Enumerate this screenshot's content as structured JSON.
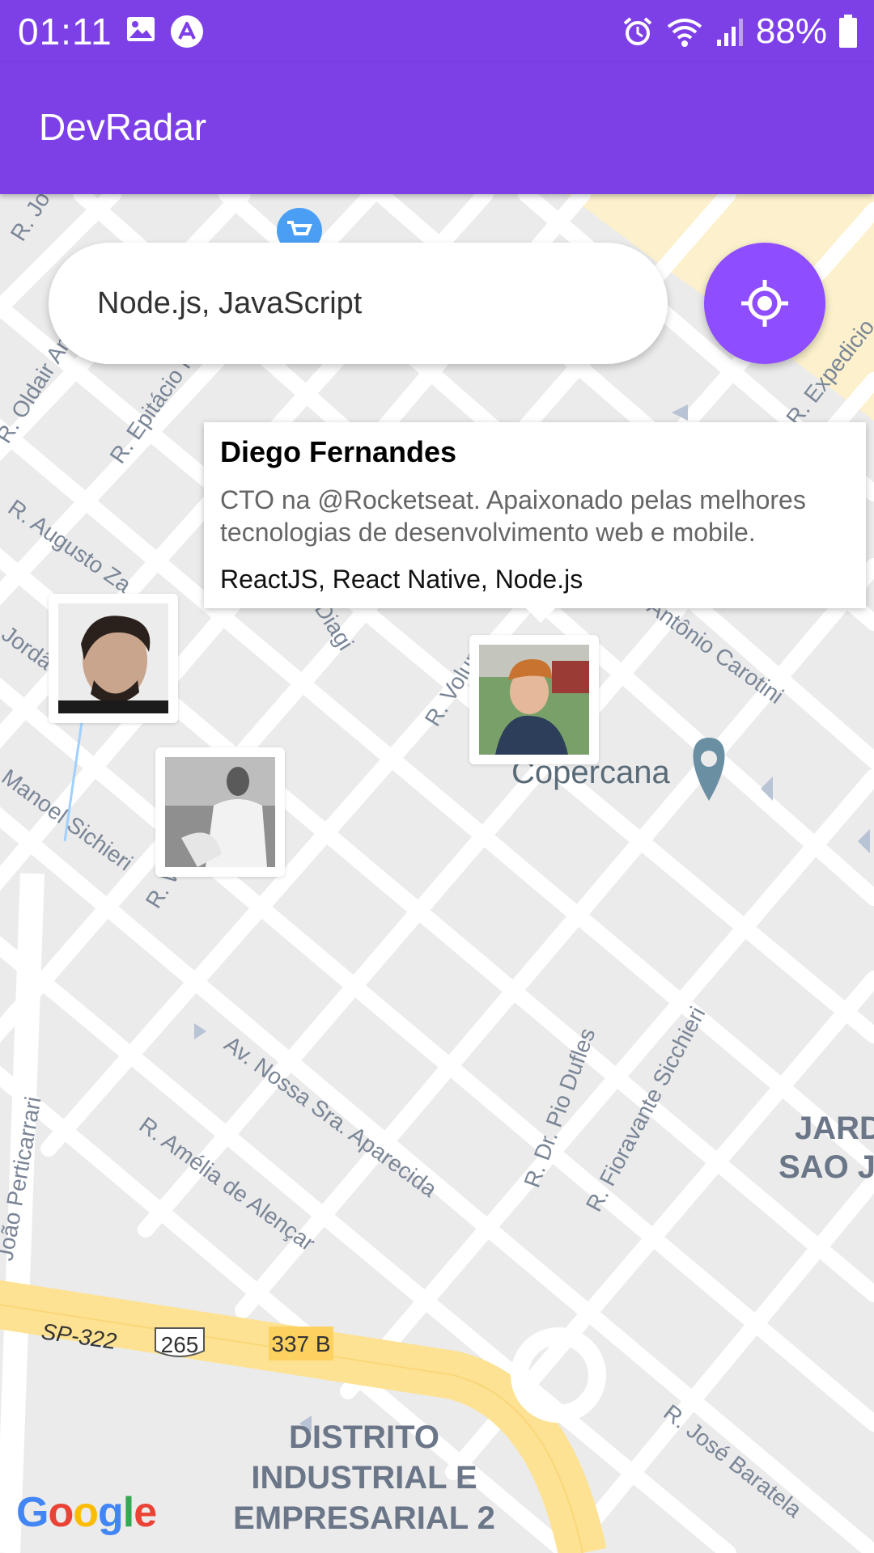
{
  "status_bar": {
    "time": "01:11",
    "battery": "88%",
    "icons": [
      "image-icon",
      "app-a-icon",
      "alarm-icon",
      "wifi-icon",
      "signal-icon",
      "battery-icon"
    ]
  },
  "app_bar": {
    "title": "DevRadar"
  },
  "search": {
    "value": "Node.js, JavaScript",
    "placeholder": ""
  },
  "locate_button": {
    "icon": "my-location-icon",
    "color": "#8e4dff"
  },
  "callout": {
    "name": "Diego Fernandes",
    "bio": "CTO na @Rocketseat. Apaixonado pelas melhores tecnologias de desenvolvimento web e mobile.",
    "techs": "ReactJS, React Native, Node.js"
  },
  "map": {
    "streets": [
      "R. Jo",
      "R. Oldair Am",
      "R. Epitácio",
      "R. Expedicio",
      "R. Augusto Za",
      "Diagi",
      "R. Volunt",
      "Antônio Carotini",
      "R. Jordã",
      "Manoel Sichieri",
      "R. W",
      "Av. Nossa Sra. Aparecida",
      "R. Amélia de Alençar",
      "R. Dr. Pio Dufles",
      "R. Fioravante Sicchieri",
      "R. José Baratela",
      "João Perticarrari",
      "SP-322"
    ],
    "places": [
      "Copercana"
    ],
    "districts": [
      "JARD",
      "SAO J",
      "DISTRITO",
      "INDUSTRIAL E",
      "EMPRESARIAL 2"
    ],
    "road_shields": [
      "265",
      "337 B"
    ]
  },
  "branding": {
    "map_provider": "Google"
  },
  "colors": {
    "primary": "#7d40e7",
    "accent": "#8e4dff"
  }
}
